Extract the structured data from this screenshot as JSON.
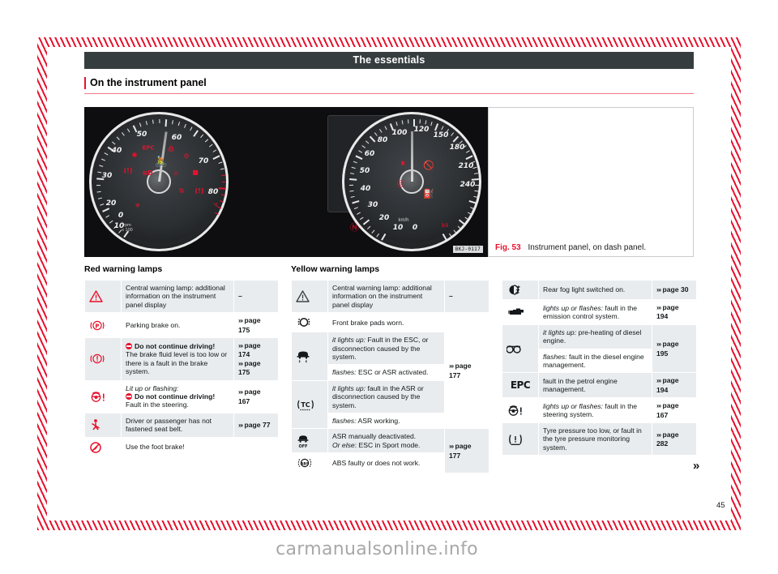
{
  "header": {
    "title": "The essentials"
  },
  "section": {
    "title": "On the instrument panel"
  },
  "figure": {
    "label": "Fig. 53",
    "caption": "Instrument panel, on dash panel.",
    "image_code": "BKJ-0117",
    "tacho": {
      "unit_line1": "rpm",
      "unit_line2": "x 100",
      "ticks": [
        "0",
        "10",
        "20",
        "30",
        "40",
        "50",
        "60",
        "70",
        "80"
      ],
      "temp_label": "°C",
      "temp_marks": [
        "90",
        "50"
      ],
      "lamps": [
        "EPC",
        "engine",
        "abs",
        "airbag",
        "esc",
        "brake-fluid",
        "headlight",
        "seatbelt",
        "tc",
        "snowflake",
        "glow-plug",
        "steering"
      ]
    },
    "speedo": {
      "unit": "km/h",
      "ticks": [
        "0",
        "10",
        "20",
        "30",
        "40",
        "50",
        "60",
        "80",
        "100",
        "120",
        "150",
        "180",
        "210",
        "240"
      ],
      "fuel_label": "1/1",
      "fuel_marks": [
        "0",
        "R"
      ],
      "lamps": [
        "rear-fog",
        "brake-pads",
        "no-entry",
        "fuel-reserve"
      ]
    },
    "lower_lamps": [
      "parking-brake",
      "central-warning",
      "fuel-cap"
    ]
  },
  "columns": [
    {
      "heading": "Red warning lamps",
      "rows": [
        {
          "icon": "central-warning-triangle-icon",
          "lines": [
            {
              "text": "Central warning lamp: additional information on the instrument panel display"
            }
          ],
          "page": "–",
          "page_plain": true
        },
        {
          "icon": "parking-brake-icon",
          "lines": [
            {
              "text": "Parking brake on."
            }
          ],
          "page": "page 175"
        },
        {
          "icon": "brake-fluid-icon",
          "lines": [
            {
              "stop": true,
              "bold": "Do not continue driving!"
            },
            {
              "text": "The brake fluid level is too low or there is a fault in the brake system."
            }
          ],
          "page": "page 174",
          "page2": "page 175"
        },
        {
          "icon": "steering-fault-icon",
          "lines": [
            {
              "italic": "Lit up or flashing:"
            },
            {
              "stop": true,
              "bold": "Do not continue driving!"
            },
            {
              "text": "Fault in the steering."
            }
          ],
          "page": "page 167"
        },
        {
          "icon": "seat-belt-icon",
          "lines": [
            {
              "text": "Driver or passenger has not fastened seat belt."
            }
          ],
          "page": "page 77"
        },
        {
          "icon": "foot-brake-icon",
          "lines": [
            {
              "text": "Use the foot brake!"
            }
          ],
          "page": ""
        }
      ]
    },
    {
      "heading": "Yellow warning lamps",
      "rows": [
        {
          "icon": "central-warning-triangle-icon",
          "lines": [
            {
              "text": "Central warning lamp: additional information on the instrument panel display"
            }
          ],
          "page": "–",
          "page_plain": true
        },
        {
          "icon": "brake-pads-icon",
          "lines": [
            {
              "text": "Front brake pads worn."
            }
          ],
          "page": ""
        },
        {
          "icon": "esc-icon",
          "lines": [
            {
              "italic": "it lights up:",
              "text": " Fault in the ESC, or disconnection caused by the system."
            }
          ],
          "page": ""
        },
        {
          "icon": "esc-icon-2",
          "lines": [
            {
              "italic": "flashes:",
              "text": " ESC or ASR activated."
            }
          ],
          "page": "page 177"
        },
        {
          "icon": "tc-icon",
          "lines": [
            {
              "italic": "it lights up:",
              "text": " fault in the ASR or disconnection caused by the system."
            }
          ],
          "page": ""
        },
        {
          "icon": "tc-icon-2",
          "lines": [
            {
              "italic": "flashes:",
              "text": " ASR working."
            }
          ],
          "page": ""
        },
        {
          "icon": "esc-off-icon",
          "lines": [
            {
              "text": "ASR manually deactivated."
            },
            {
              "italic": "Or else",
              "text": ": ESC in Sport mode."
            }
          ],
          "page": "page 177"
        },
        {
          "icon": "abs-icon",
          "lines": [
            {
              "text": "ABS faulty or does not work."
            }
          ],
          "page": ""
        }
      ]
    },
    {
      "heading": "",
      "rows": [
        {
          "icon": "rear-fog-light-icon",
          "lines": [
            {
              "text": "Rear fog light switched on."
            }
          ],
          "page": "page 30"
        },
        {
          "icon": "emission-control-icon",
          "lines": [
            {
              "italic": "lights up or flashes:",
              "text": " fault in the emission control system."
            }
          ],
          "page": "page 194"
        },
        {
          "icon": "glow-plug-icon",
          "lines": [
            {
              "italic": "it lights up:",
              "text": " pre-heating of diesel engine."
            }
          ],
          "page": "page 195"
        },
        {
          "icon": "glow-plug-icon-2",
          "lines": [
            {
              "italic": "flashes:",
              "text": " fault in the diesel engine management."
            }
          ],
          "page": ""
        },
        {
          "icon": "epc-icon",
          "lines": [
            {
              "text": "fault in the petrol engine management."
            }
          ],
          "page": "page 194"
        },
        {
          "icon": "steering-fault-icon",
          "lines": [
            {
              "italic": "lights up or flashes:",
              "text": " fault in the steering system."
            }
          ],
          "page": "page 167"
        },
        {
          "icon": "tyre-pressure-icon",
          "lines": [
            {
              "text": "Tyre pressure too low, or fault in the tyre pressure monitoring system."
            }
          ],
          "page": "page 282"
        }
      ]
    }
  ],
  "next_page_marker": "»",
  "page_number": "45",
  "watermark": "carmanualsonline.info"
}
